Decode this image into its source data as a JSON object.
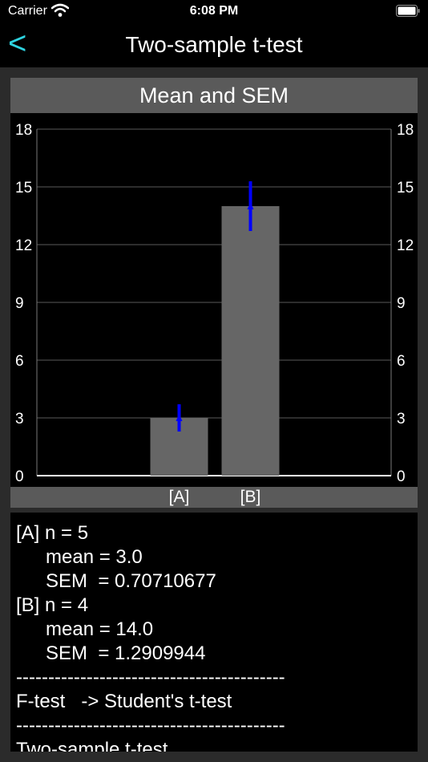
{
  "status": {
    "carrier": "Carrier",
    "time": "6:08 PM"
  },
  "nav": {
    "back": "<",
    "title": "Two-sample t-test"
  },
  "chart": {
    "header": "Mean and SEM"
  },
  "chart_data": {
    "type": "bar",
    "title": "Mean and SEM",
    "categories": [
      "[A]",
      "[B]"
    ],
    "values": [
      3.0,
      14.0
    ],
    "error_bars": [
      0.70710677,
      1.2909944
    ],
    "ylim": [
      0,
      18
    ],
    "yticks": [
      0,
      3,
      6,
      9,
      12,
      15,
      18
    ],
    "grid": true,
    "bar_color": "#666666",
    "error_color": "#0000ff"
  },
  "results": {
    "lines": [
      {
        "text": "[A] n = 5",
        "indent": 0
      },
      {
        "text": "mean = 3.0",
        "indent": 1
      },
      {
        "text": "SEM  = 0.70710677",
        "indent": 1
      },
      {
        "text": "[B] n = 4",
        "indent": 0
      },
      {
        "text": "mean = 14.0",
        "indent": 1
      },
      {
        "text": "SEM  = 1.2909944",
        "indent": 1
      },
      {
        "text": "------------------------------------------",
        "indent": 0
      },
      {
        "text": "F-test   -> Student's t-test",
        "indent": 0
      },
      {
        "text": "------------------------------------------",
        "indent": 0
      },
      {
        "text": "Two-sample t-test",
        "indent": 0
      }
    ]
  }
}
